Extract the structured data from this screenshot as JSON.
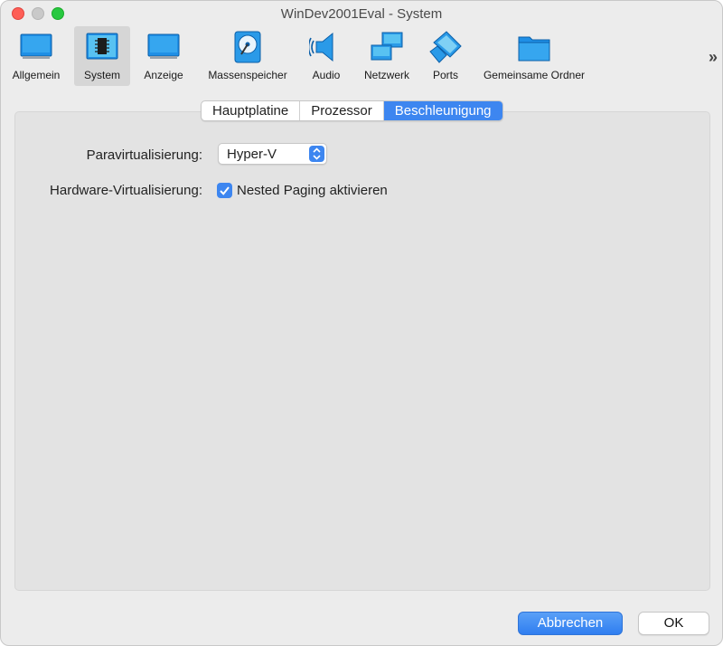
{
  "window": {
    "title": "WinDev2001Eval - System"
  },
  "toolbar": {
    "items": [
      {
        "label": "Allgemein",
        "icon": "monitor-icon"
      },
      {
        "label": "System",
        "icon": "chip-icon",
        "selected": true
      },
      {
        "label": "Anzeige",
        "icon": "display-icon"
      },
      {
        "label": "Massenspeicher",
        "icon": "hard-disk-icon"
      },
      {
        "label": "Audio",
        "icon": "speaker-icon"
      },
      {
        "label": "Netzwerk",
        "icon": "network-icon"
      },
      {
        "label": "Ports",
        "icon": "port-icon"
      },
      {
        "label": "Gemeinsame Ordner",
        "icon": "folder-icon"
      }
    ],
    "more": "»"
  },
  "tabs": [
    {
      "label": "Hauptplatine",
      "active": false
    },
    {
      "label": "Prozessor",
      "active": false
    },
    {
      "label": "Beschleunigung",
      "active": true
    }
  ],
  "form": {
    "paravirt_label": "Paravirtualisierung:",
    "paravirt_value": "Hyper-V",
    "hwvirt_label": "Hardware-Virtualisierung:",
    "nested_paging_label": "Nested Paging aktivieren",
    "nested_paging_checked": true
  },
  "buttons": {
    "cancel": "Abbrechen",
    "ok": "OK"
  },
  "colors": {
    "accent": "#3d86f0",
    "panel": "#e3e3e3",
    "window": "#ececec"
  }
}
